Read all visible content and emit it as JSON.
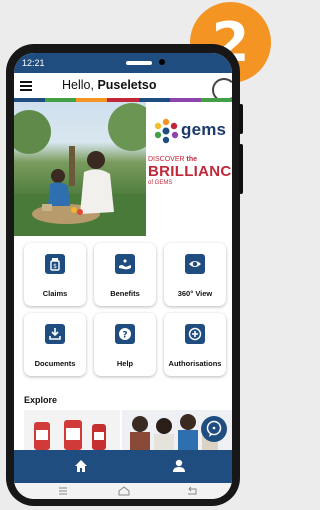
{
  "step_badge": "2",
  "status_bar": {
    "time": "12:21"
  },
  "header": {
    "greeting_prefix": "Hello,",
    "user_name": "Puseletso"
  },
  "brand_stripe": [
    "#1f4d80",
    "#43a047",
    "#f39423",
    "#c0283a",
    "#1f4d80",
    "#8e44ad",
    "#43a047"
  ],
  "banner": {
    "logo_text": "gems",
    "logo_subtitle": "",
    "discover": "DISCOVER",
    "the": "the",
    "brilliance": "BRILLIANCE",
    "of_gems": "of GEMS"
  },
  "tiles": [
    {
      "label": "Claims",
      "icon": "claims-icon"
    },
    {
      "label": "Benefits",
      "icon": "benefits-icon"
    },
    {
      "label": "360° View",
      "icon": "eye-icon"
    },
    {
      "label": "Documents",
      "icon": "download-icon"
    },
    {
      "label": "Help",
      "icon": "help-icon"
    },
    {
      "label": "Authorisations",
      "icon": "plus-icon"
    }
  ],
  "explore": {
    "title": "Explore"
  },
  "bottom_nav": [
    {
      "icon": "home-icon"
    },
    {
      "icon": "user-icon"
    }
  ],
  "colors": {
    "brand_blue": "#1f4d80",
    "badge_orange": "#f39423",
    "brand_red": "#c0283a"
  }
}
